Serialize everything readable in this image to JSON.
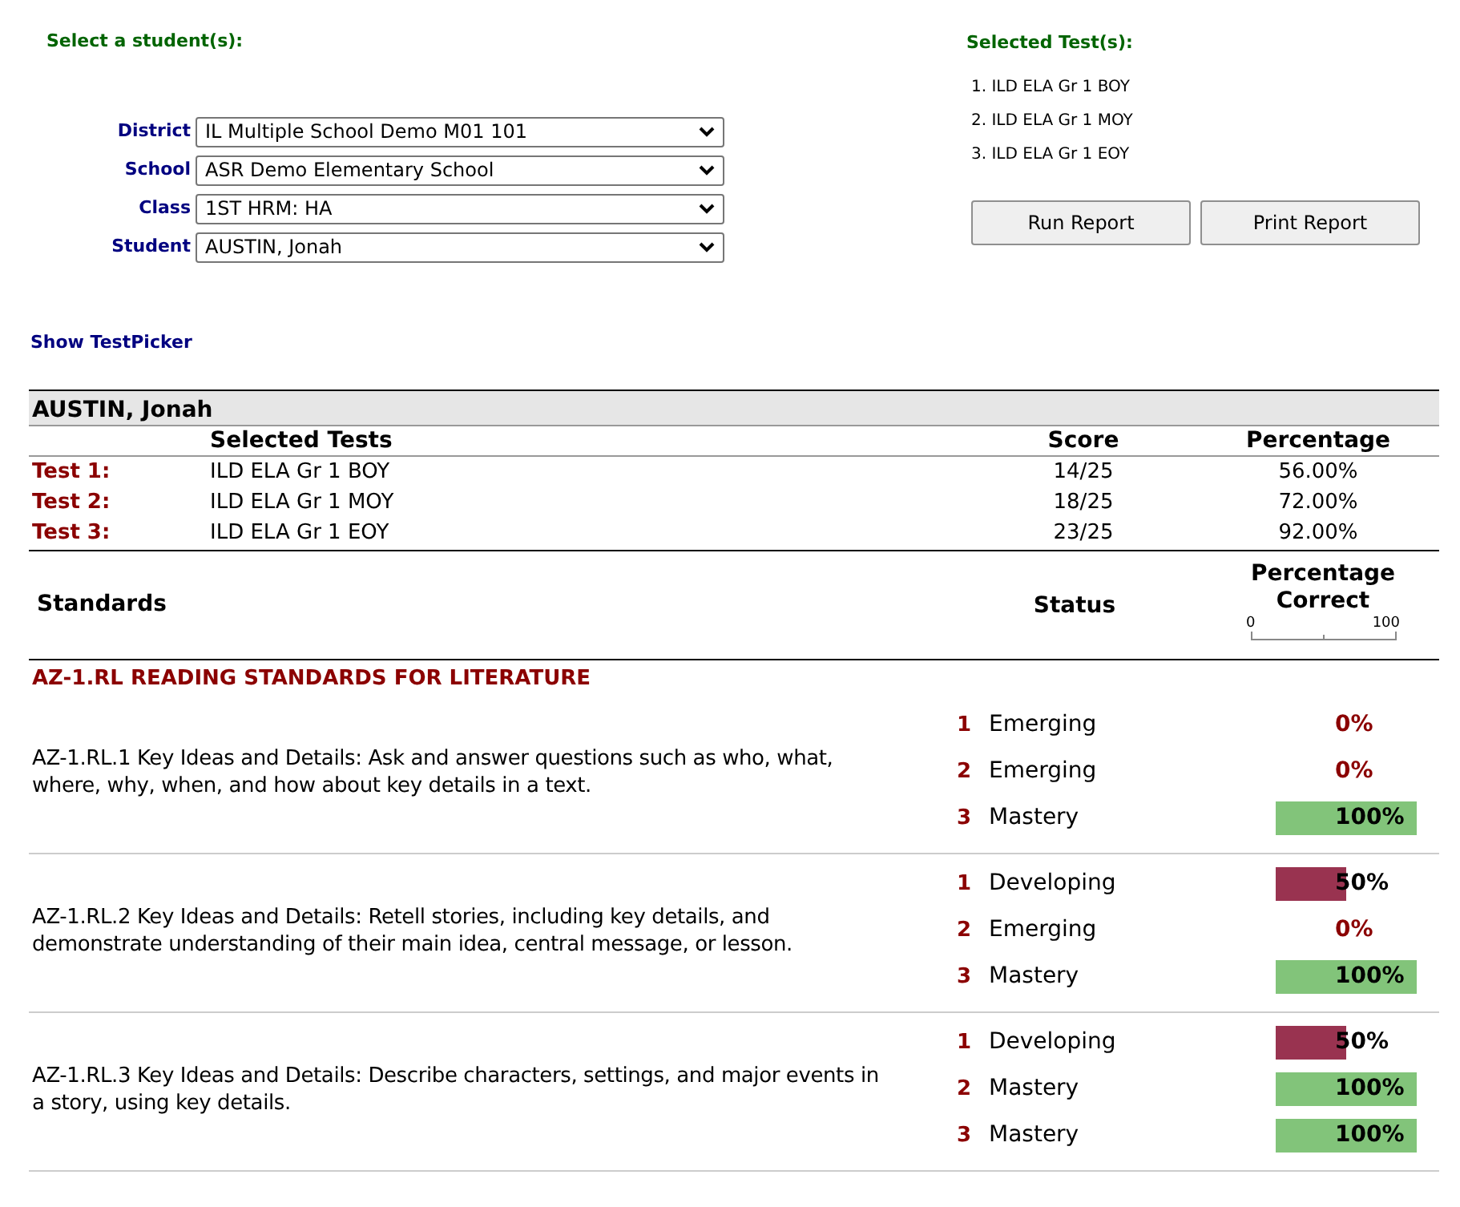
{
  "selector": {
    "title": "Select a student(s):",
    "fields": [
      {
        "label": "District",
        "value": "IL Multiple School Demo M01 101"
      },
      {
        "label": "School",
        "value": "ASR Demo Elementary School"
      },
      {
        "label": "Class",
        "value": "1ST HRM: HA"
      },
      {
        "label": "Student",
        "value": "AUSTIN, Jonah"
      }
    ],
    "link": "Show TestPicker"
  },
  "selected_tests": {
    "title": "Selected Test(s):",
    "items": [
      "1. ILD ELA Gr 1 BOY",
      "2. ILD ELA Gr 1 MOY",
      "3. ILD ELA Gr 1 EOY"
    ],
    "buttons": [
      "Run Report",
      "Print Report"
    ]
  },
  "report": {
    "student": "AUSTIN, Jonah",
    "columns": [
      "Selected Tests",
      "Score",
      "Percentage"
    ],
    "tests": [
      {
        "label": "Test 1:",
        "name": "ILD ELA Gr 1 BOY",
        "score": "14/25",
        "percentage": "56.00%"
      },
      {
        "label": "Test 2:",
        "name": "ILD ELA Gr 1 MOY",
        "score": "18/25",
        "percentage": "72.00%"
      },
      {
        "label": "Test 3:",
        "name": "ILD ELA Gr 1 EOY",
        "score": "23/25",
        "percentage": "92.00%"
      }
    ],
    "standards_header": {
      "standards": "Standards",
      "status": "Status",
      "percentage": "Percentage Correct",
      "scale_min": "0",
      "scale_max": "100"
    },
    "section": "AZ-1.RL READING STANDARDS FOR LITERATURE",
    "standards": [
      {
        "text": "AZ-1.RL.1 Key Ideas and Details: Ask and answer questions such as who, what, where, why, when, and how about key details in a text.",
        "results": [
          {
            "number": "1",
            "status": "Emerging",
            "kind": "emerging",
            "level": 0,
            "reading": "0%"
          },
          {
            "number": "2",
            "status": "Emerging",
            "kind": "emerging",
            "level": 0,
            "reading": "0%"
          },
          {
            "number": "3",
            "status": "Mastery",
            "kind": "mastery",
            "level": 1,
            "reading": "100%"
          }
        ]
      },
      {
        "text": "AZ-1.RL.2 Key Ideas and Details: Retell stories, including key details, and demonstrate understanding of their main idea, central message, or lesson.",
        "results": [
          {
            "number": "1",
            "status": "Developing",
            "kind": "developing",
            "level": 0.5,
            "reading": "50%"
          },
          {
            "number": "2",
            "status": "Emerging",
            "kind": "emerging",
            "level": 0,
            "reading": "0%"
          },
          {
            "number": "3",
            "status": "Mastery",
            "kind": "mastery",
            "level": 1,
            "reading": "100%"
          }
        ]
      },
      {
        "text": "AZ-1.RL.3 Key Ideas and Details: Describe characters, settings, and major events in a story, using key details.",
        "results": [
          {
            "number": "1",
            "status": "Developing",
            "kind": "developing",
            "level": 0.5,
            "reading": "50%"
          },
          {
            "number": "2",
            "status": "Mastery",
            "kind": "mastery",
            "level": 1,
            "reading": "100%"
          },
          {
            "number": "3",
            "status": "Mastery",
            "kind": "mastery",
            "level": 1,
            "reading": "100%"
          }
        ]
      }
    ]
  }
}
